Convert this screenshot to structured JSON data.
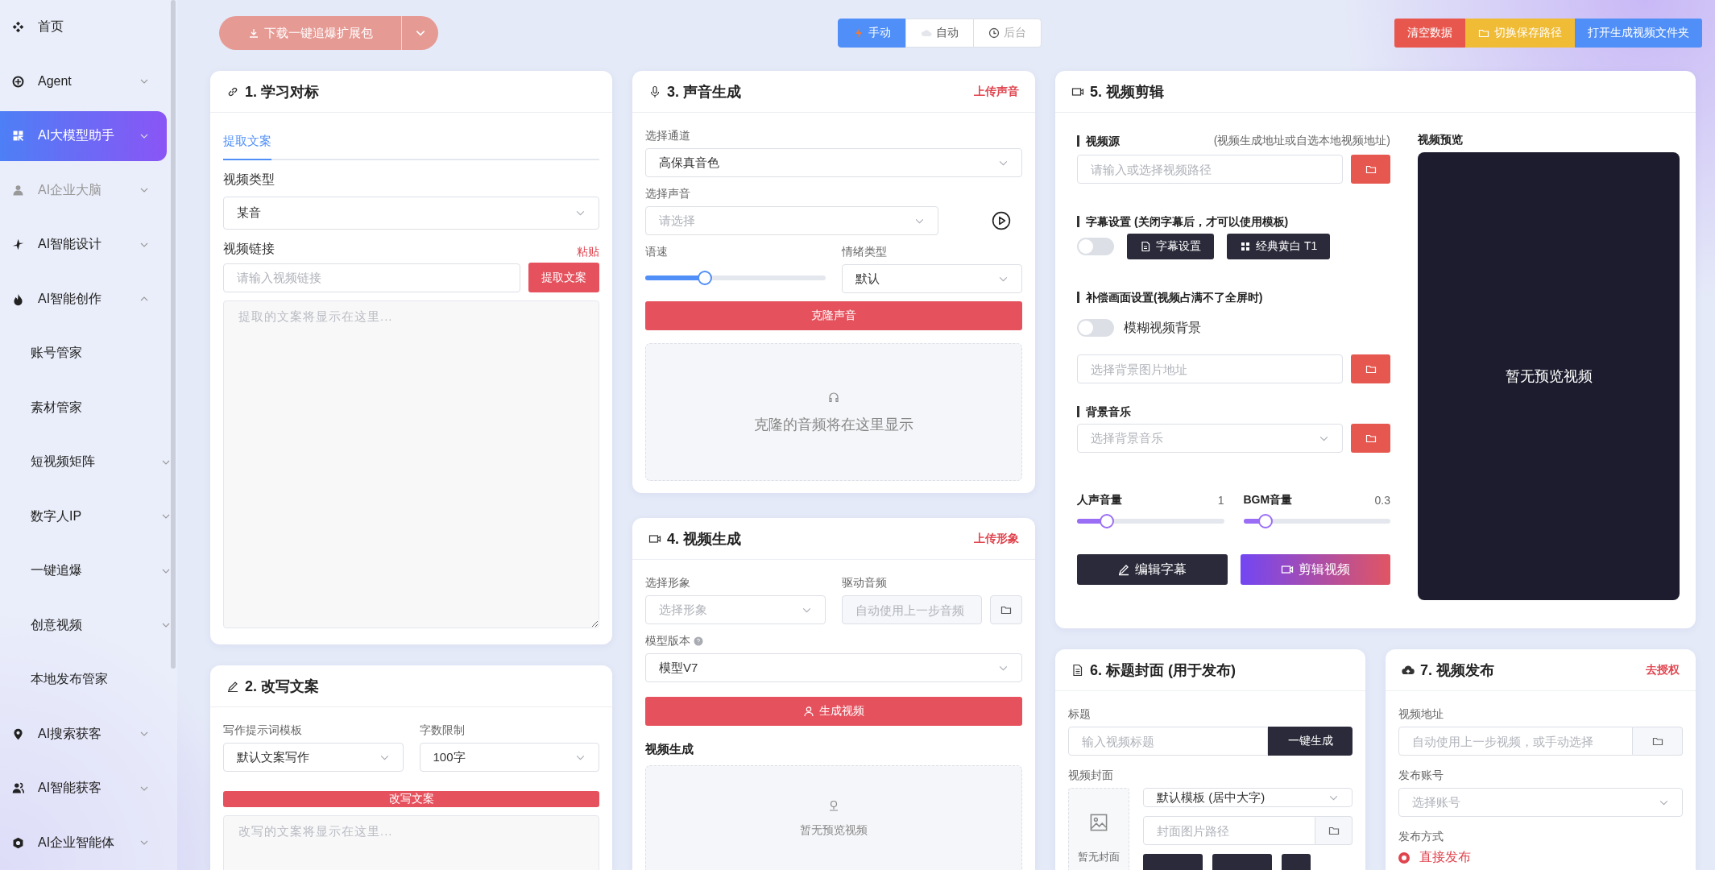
{
  "sidebar": {
    "items": [
      {
        "label": "首页",
        "selected": false,
        "disabled": false
      },
      {
        "label": "Agent",
        "selected": false,
        "disabled": false,
        "expanded": false
      },
      {
        "label": "AI大模型助手",
        "selected": true,
        "disabled": false,
        "expanded": false
      },
      {
        "label": "AI企业大脑",
        "selected": false,
        "disabled": true,
        "expanded": false
      },
      {
        "label": "AI智能设计",
        "selected": false,
        "disabled": false,
        "expanded": false
      },
      {
        "label": "AI智能创作",
        "selected": false,
        "disabled": false,
        "expanded": true,
        "children": [
          {
            "label": "账号管家",
            "selected": false
          },
          {
            "label": "素材管家",
            "selected": false
          },
          {
            "label": "短视频矩阵",
            "selected": false,
            "expanded": false
          },
          {
            "label": "数字人IP",
            "selected": false,
            "expanded": false
          },
          {
            "label": "一键追爆",
            "selected": false,
            "expanded": false
          },
          {
            "label": "创意视频",
            "selected": false,
            "expanded": false
          },
          {
            "label": "本地发布管家",
            "selected": false
          }
        ]
      },
      {
        "label": "AI搜索获客",
        "selected": false,
        "disabled": false,
        "expanded": false
      },
      {
        "label": "AI智能获客",
        "selected": false,
        "disabled": false,
        "expanded": false
      },
      {
        "label": "AI企业智能体",
        "selected": false,
        "disabled": false,
        "expanded": false
      }
    ]
  },
  "toolbar": {
    "download_button": "下载一键追爆扩展包",
    "modes": [
      {
        "label": "手动",
        "selected": true,
        "disabled": false
      },
      {
        "label": "自动",
        "selected": false,
        "disabled": false
      },
      {
        "label": "后台",
        "selected": false,
        "disabled": true
      }
    ],
    "actions": [
      {
        "label": "清空数据",
        "color": "#e8574e"
      },
      {
        "label": "切换保存路径",
        "color": "#f0bb35"
      },
      {
        "label": "打开生成视频文件夹",
        "color": "#4f8ff7"
      }
    ]
  },
  "learn": {
    "title": "1. 学习对标",
    "tabs": [
      {
        "label": "提取文案",
        "selected": true
      }
    ],
    "type_label": "视频类型",
    "type_value": "某音",
    "link_label": "视频链接",
    "paste": "粘贴",
    "link_placeholder": "请输入视频链接",
    "extract_button": "提取文案",
    "result_placeholder": "提取的文案将显示在这里..."
  },
  "rewrite": {
    "title": "2. 改写文案",
    "template_label": "写作提示词模板",
    "template_value": "默认文案写作",
    "limit_label": "字数限制",
    "limit_value": "100字",
    "button": "改写文案",
    "result_placeholder": "改写的文案将显示在这里..."
  },
  "voice": {
    "title": "3. 声音生成",
    "action": "上传声音",
    "channel_label": "选择通道",
    "channel_value": "高保真音色",
    "voice_label": "选择声音",
    "voice_placeholder": "请选择",
    "speed_label": "语速",
    "speed": {
      "level": 0.33
    },
    "emotion_label": "情绪类型",
    "emotion_value": "默认",
    "button": "克隆声音",
    "result_placeholder": "克隆的音频将在这里显示"
  },
  "video_gen": {
    "title": "4. 视频生成",
    "action": "上传形象",
    "avatar_label": "选择形象",
    "avatar_placeholder": "选择形象",
    "audio_label": "驱动音频",
    "audio_placeholder": "自动使用上一步音频",
    "model_label": "模型版本",
    "model_value": "模型V7",
    "button": "生成视频",
    "section": "视频生成",
    "result_placeholder": "暂无预览视频"
  },
  "edit": {
    "title": "5. 视频剪辑",
    "source_label": "视频源",
    "source_hint": "(视频生成地址或自选本地视频地址)",
    "source_placeholder": "请输入或选择视频路径",
    "subtitle_label": "字幕设置 (关闭字幕后，才可以使用模板)",
    "subtitle_switch": {
      "on": false
    },
    "subtitle_button": "字幕设置",
    "template_button": "经典黄白 T1",
    "fill_label": "补偿画面设置(视频占满不了全屏时)",
    "blur_switch": {
      "on": false,
      "label": "模糊视频背景"
    },
    "background_placeholder": "选择背景图片地址",
    "music_label": "背景音乐",
    "music_placeholder": "选择背景音乐",
    "voice_volume": {
      "label": "人声音量",
      "reading": "1",
      "level": 0.2
    },
    "bgm_volume": {
      "label": "BGM音量",
      "reading": "0.3",
      "level": 0.15
    },
    "edit_subtitle_button": "编辑字幕",
    "cut_button": "剪辑视频",
    "preview_label": "视频预览",
    "preview_message": "暂无预览视频"
  },
  "cover": {
    "title": "6. 标题封面 (用于发布)",
    "title_label": "标题",
    "title_placeholder": "输入视频标题",
    "generate_button": "一键生成",
    "cover_label": "视频封面",
    "cover_hint": "暂无封面",
    "template_value": "默认模板 (居中大字)",
    "path_placeholder": "封面图片路径"
  },
  "publish": {
    "title": "7. 视频发布",
    "action": "去授权",
    "address_label": "视频地址",
    "address_placeholder": "自动使用上一步视频，或手动选择",
    "account_label": "发布账号",
    "account_placeholder": "选择账号",
    "method_label": "发布方式",
    "methods": [
      {
        "label": "直接发布",
        "selected": true
      }
    ]
  }
}
